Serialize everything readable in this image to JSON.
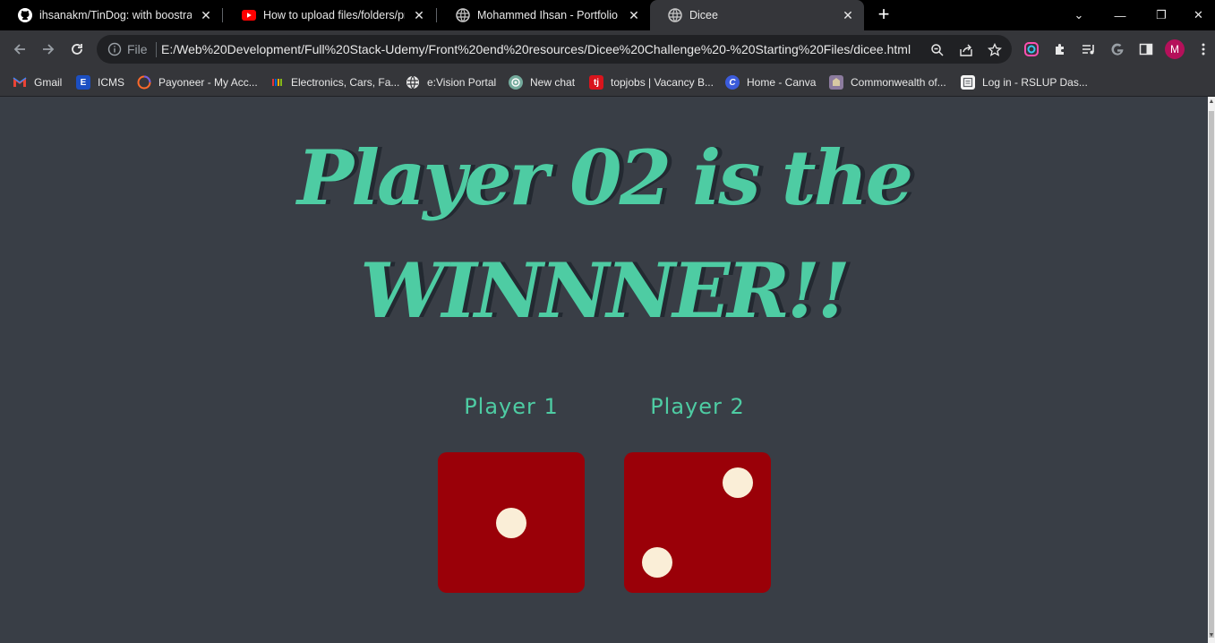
{
  "browser": {
    "tabs": [
      {
        "title": "ihsanakm/TinDog: with boostrap",
        "icon": "github-icon",
        "active": false
      },
      {
        "title": "How to upload files/folders/proje",
        "icon": "youtube-icon",
        "active": false
      },
      {
        "title": "Mohammed Ihsan - Portfolio",
        "icon": "globe-icon",
        "active": false
      },
      {
        "title": "Dicee",
        "icon": "globe-icon",
        "active": true
      }
    ],
    "address": {
      "scheme_label": "File",
      "url": "E:/Web%20Development/Full%20Stack-Udemy/Front%20end%20resources/Dicee%20Challenge%20-%20Starting%20Files/dicee.html"
    },
    "profile_initial": "M",
    "bookmarks": [
      {
        "label": "Gmail",
        "icon": "gmail-icon"
      },
      {
        "label": "ICMS",
        "icon": "icms-icon"
      },
      {
        "label": "Payoneer - My Acc...",
        "icon": "payoneer-icon"
      },
      {
        "label": "Electronics, Cars, Fa...",
        "icon": "ebay-icon"
      },
      {
        "label": "e:Vision Portal",
        "icon": "globe-icon"
      },
      {
        "label": "New chat",
        "icon": "openai-icon"
      },
      {
        "label": "topjobs | Vacancy B...",
        "icon": "topjobs-icon"
      },
      {
        "label": "Home - Canva",
        "icon": "canva-icon"
      },
      {
        "label": "Commonwealth of...",
        "icon": "commonwealth-icon"
      },
      {
        "label": "Log in - RSLUP Das...",
        "icon": "page-icon"
      }
    ]
  },
  "page": {
    "heading_line1": "Player 02 is the",
    "heading_line2": "WINNNER!!",
    "players": [
      {
        "label": "Player 1",
        "dice_value": 1
      },
      {
        "label": "Player 2",
        "dice_value": 2
      }
    ],
    "colors": {
      "background": "#393E46",
      "accent": "#4ECCA3",
      "dice": "#9a0008",
      "pip": "#faeed7"
    }
  }
}
